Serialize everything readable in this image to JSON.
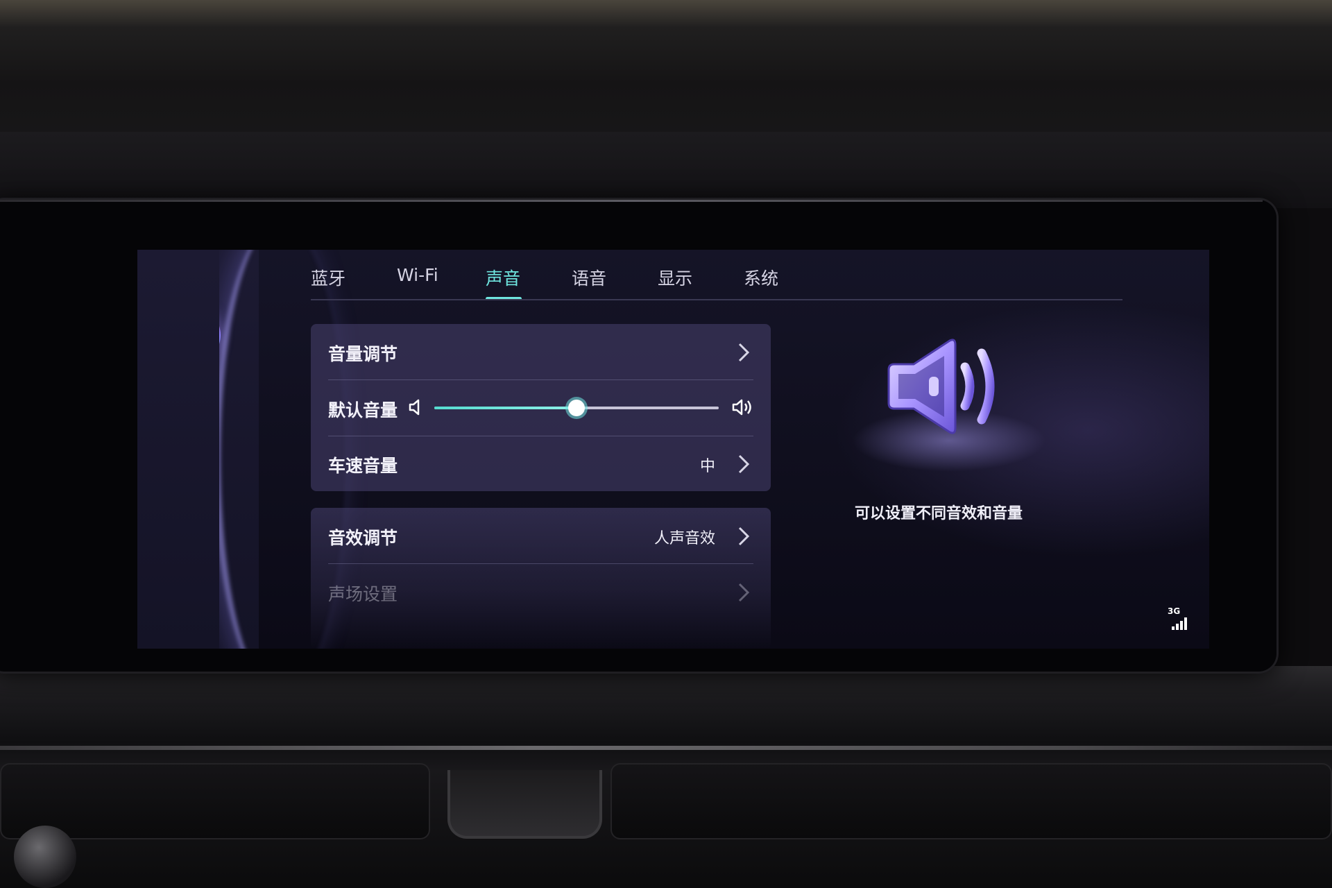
{
  "tabs": [
    {
      "label": "蓝牙",
      "active": false
    },
    {
      "label": "Wi-Fi",
      "active": false
    },
    {
      "label": "声音",
      "active": true
    },
    {
      "label": "语音",
      "active": false
    },
    {
      "label": "显示",
      "active": false
    },
    {
      "label": "系统",
      "active": false
    }
  ],
  "sidebar": {
    "items": [
      {
        "icon": "assistant-avatar-icon"
      },
      {
        "icon": "home-icon"
      },
      {
        "icon": "music-note-icon"
      },
      {
        "icon": "map-pin-icon"
      },
      {
        "icon": "apps-grid-icon"
      }
    ]
  },
  "volume_card": {
    "volume_adjust_label": "音量调节",
    "default_volume_label": "默认音量",
    "default_volume_level": 0.5,
    "speed_volume_label": "车速音量",
    "speed_volume_value": "中"
  },
  "effects_card": {
    "sound_effect_label": "音效调节",
    "sound_effect_value": "人声音效",
    "sound_field_label": "声场设置"
  },
  "panel": {
    "hint": "可以设置不同音效和音量",
    "icon": "speaker-volume-icon"
  },
  "status": {
    "network_label": "3G"
  },
  "colors": {
    "accent": "#6fe6e0",
    "card": "#484270",
    "icon_purple": "#b7a9ff"
  }
}
